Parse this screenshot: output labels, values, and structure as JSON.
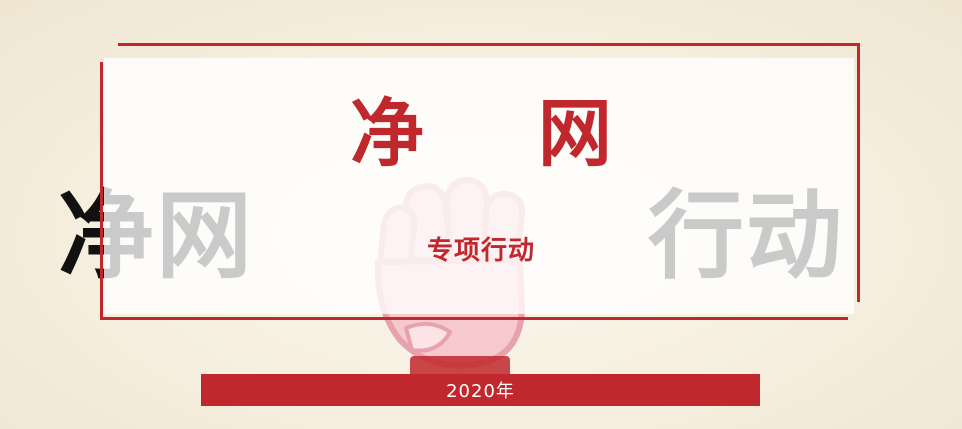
{
  "banner": {
    "title": "净 网",
    "subtitle": "专项行动",
    "year": "2020年",
    "background_word_left": "净网",
    "background_word_right": "行动"
  },
  "colors": {
    "accent": "#c0282d",
    "background": "#f7f1e3",
    "fist_fill": "#f6c9cf",
    "fist_outline": "#e7a3ad"
  },
  "icons": {
    "fist": "fist-illustration"
  }
}
